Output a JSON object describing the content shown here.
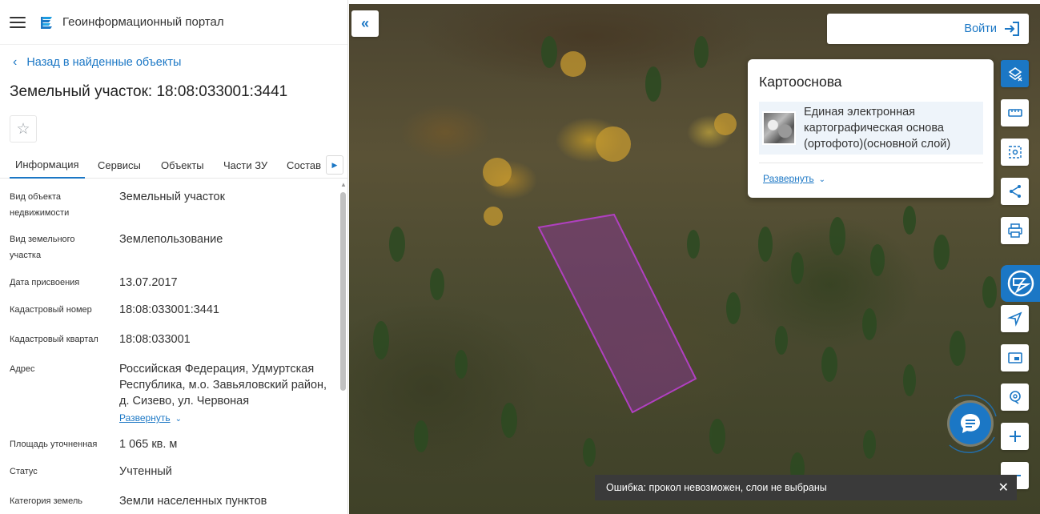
{
  "header": {
    "title": "Геоинформационный портал"
  },
  "nav": {
    "back_label": "Назад в найденные объекты"
  },
  "object": {
    "title": "Земельный участок: 18:08:033001:3441"
  },
  "tabs": [
    {
      "label": "Информация",
      "active": true
    },
    {
      "label": "Сервисы",
      "active": false
    },
    {
      "label": "Объекты",
      "active": false
    },
    {
      "label": "Части ЗУ",
      "active": false
    },
    {
      "label": "Состав",
      "active": false
    }
  ],
  "properties": [
    {
      "label": "Вид объекта недвижимости",
      "value": "Земельный участок"
    },
    {
      "label": "Вид земельного участка",
      "value": "Землепользование"
    },
    {
      "label": "Дата присвоения",
      "value": "13.07.2017"
    },
    {
      "label": "Кадастровый номер",
      "value": "18:08:033001:3441"
    },
    {
      "label": "Кадастровый квартал",
      "value": "18:08:033001"
    },
    {
      "label": "Адрес",
      "value": "Российская Федерация, Удмуртская Республика, м.о. Завьяловский район, д. Сизево, ул. Червоная",
      "expand_label": "Развернуть"
    },
    {
      "label": "Площадь уточненная",
      "value": "1 065 кв. м"
    },
    {
      "label": "Статус",
      "value": "Учтенный"
    },
    {
      "label": "Категория земель",
      "value": "Земли населенных пунктов"
    }
  ],
  "login": {
    "label": "Войти"
  },
  "basemap": {
    "title": "Картооснова",
    "layer_name": "Единая электронная картографическая основа (ортофото)(основной слой)",
    "expand_label": "Развернуть"
  },
  "toast": {
    "message": "Ошибка: прокол невозможен, слои не выбраны"
  },
  "colors": {
    "accent": "#1b77c5",
    "parcel": "#b040c0",
    "toast_bg": "#3a3a3a"
  }
}
